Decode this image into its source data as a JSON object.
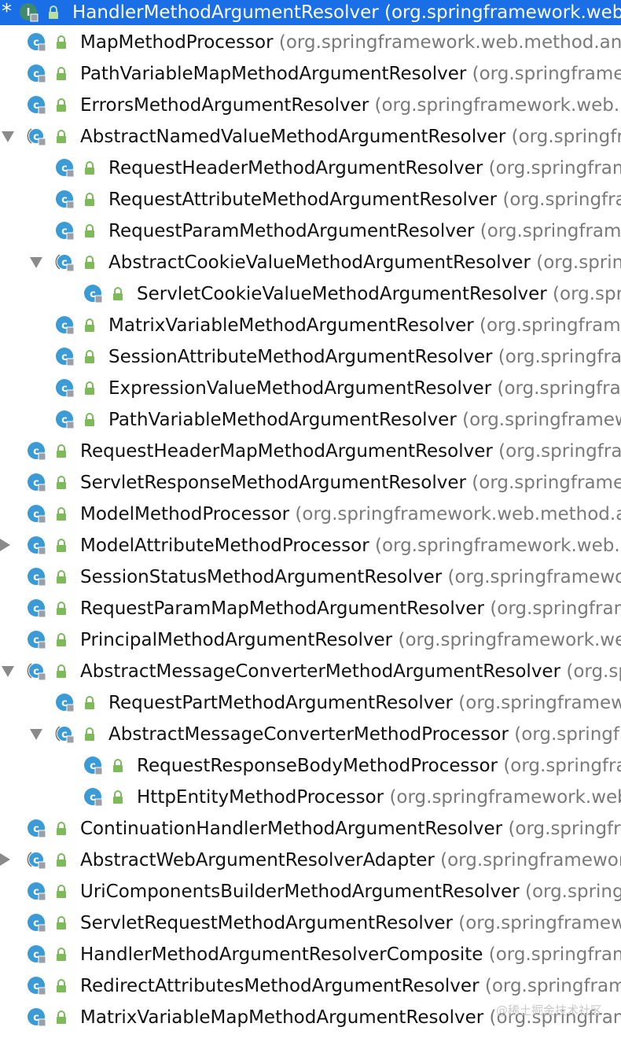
{
  "colors": {
    "selection": "#1a6fe6",
    "class_icon": "#3a9bd5",
    "interface_icon": "#3f8a6a",
    "lock_icon": "#7dba5a",
    "text": "#111111",
    "package_text": "#7a7a7a"
  },
  "header": {
    "marker": "*",
    "name": "HandlerMethodArgumentResolver",
    "pkg": "(org.springframework.web.method.support)",
    "icon": "interface-icon"
  },
  "items": [
    {
      "name": "MapMethodProcessor",
      "pkg": "(org.springframework.web.method.annotation)",
      "icon": "class-icon",
      "depth": 0,
      "toggle": ""
    },
    {
      "name": "PathVariableMapMethodArgumentResolver",
      "pkg": "(org.springframework.web.servlet.mvc.method.annotation)",
      "icon": "class-icon",
      "depth": 0,
      "toggle": ""
    },
    {
      "name": "ErrorsMethodArgumentResolver",
      "pkg": "(org.springframework.web.method.annotation)",
      "icon": "class-icon",
      "depth": 0,
      "toggle": ""
    },
    {
      "name": "AbstractNamedValueMethodArgumentResolver",
      "pkg": "(org.springframework.web.method.annotation)",
      "icon": "abstract-class-icon",
      "depth": 0,
      "toggle": "expanded"
    },
    {
      "name": "RequestHeaderMethodArgumentResolver",
      "pkg": "(org.springframework.web.method.annotation)",
      "icon": "class-icon",
      "depth": 1,
      "toggle": ""
    },
    {
      "name": "RequestAttributeMethodArgumentResolver",
      "pkg": "(org.springframework.web.servlet.mvc.method.annotation)",
      "icon": "class-icon",
      "depth": 1,
      "toggle": ""
    },
    {
      "name": "RequestParamMethodArgumentResolver",
      "pkg": "(org.springframework.web.method.annotation)",
      "icon": "class-icon",
      "depth": 1,
      "toggle": ""
    },
    {
      "name": "AbstractCookieValueMethodArgumentResolver",
      "pkg": "(org.springframework.web.method.annotation)",
      "icon": "abstract-class-icon",
      "depth": 1,
      "toggle": "expanded"
    },
    {
      "name": "ServletCookieValueMethodArgumentResolver",
      "pkg": "(org.springframework.web.servlet.mvc.method.annotation)",
      "icon": "class-icon",
      "depth": 2,
      "toggle": ""
    },
    {
      "name": "MatrixVariableMethodArgumentResolver",
      "pkg": "(org.springframework.web.servlet.mvc.method.annotation)",
      "icon": "class-icon",
      "depth": 1,
      "toggle": ""
    },
    {
      "name": "SessionAttributeMethodArgumentResolver",
      "pkg": "(org.springframework.web.servlet.mvc.method.annotation)",
      "icon": "class-icon",
      "depth": 1,
      "toggle": ""
    },
    {
      "name": "ExpressionValueMethodArgumentResolver",
      "pkg": "(org.springframework.web.method.annotation)",
      "icon": "class-icon",
      "depth": 1,
      "toggle": ""
    },
    {
      "name": "PathVariableMethodArgumentResolver",
      "pkg": "(org.springframework.web.servlet.mvc.method.annotation)",
      "icon": "class-icon",
      "depth": 1,
      "toggle": ""
    },
    {
      "name": "RequestHeaderMapMethodArgumentResolver",
      "pkg": "(org.springframework.web.method.annotation)",
      "icon": "class-icon",
      "depth": 0,
      "toggle": ""
    },
    {
      "name": "ServletResponseMethodArgumentResolver",
      "pkg": "(org.springframework.web.servlet.mvc.method.annotation)",
      "icon": "class-icon",
      "depth": 0,
      "toggle": ""
    },
    {
      "name": "ModelMethodProcessor",
      "pkg": "(org.springframework.web.method.annotation)",
      "icon": "class-icon",
      "depth": 0,
      "toggle": ""
    },
    {
      "name": "ModelAttributeMethodProcessor",
      "pkg": "(org.springframework.web.method.annotation)",
      "icon": "class-icon",
      "depth": 0,
      "toggle": "collapsed"
    },
    {
      "name": "SessionStatusMethodArgumentResolver",
      "pkg": "(org.springframework.web.method.annotation)",
      "icon": "class-icon",
      "depth": 0,
      "toggle": ""
    },
    {
      "name": "RequestParamMapMethodArgumentResolver",
      "pkg": "(org.springframework.web.method.annotation)",
      "icon": "class-icon",
      "depth": 0,
      "toggle": ""
    },
    {
      "name": "PrincipalMethodArgumentResolver",
      "pkg": "(org.springframework.web.servlet.mvc.method.annotation)",
      "icon": "class-icon",
      "depth": 0,
      "toggle": ""
    },
    {
      "name": "AbstractMessageConverterMethodArgumentResolver",
      "pkg": "(org.springframework.web.servlet.mvc.method.annotation)",
      "icon": "abstract-class-icon",
      "depth": 0,
      "toggle": "expanded"
    },
    {
      "name": "RequestPartMethodArgumentResolver",
      "pkg": "(org.springframework.web.servlet.mvc.method.annotation)",
      "icon": "class-icon",
      "depth": 1,
      "toggle": ""
    },
    {
      "name": "AbstractMessageConverterMethodProcessor",
      "pkg": "(org.springframework.web.servlet.mvc.method.annotation)",
      "icon": "abstract-class-icon",
      "depth": 1,
      "toggle": "expanded"
    },
    {
      "name": "RequestResponseBodyMethodProcessor",
      "pkg": "(org.springframework.web.servlet.mvc.method.annotation)",
      "icon": "class-icon",
      "depth": 2,
      "toggle": ""
    },
    {
      "name": "HttpEntityMethodProcessor",
      "pkg": "(org.springframework.web.servlet.mvc.method.annotation)",
      "icon": "class-icon",
      "depth": 2,
      "toggle": ""
    },
    {
      "name": "ContinuationHandlerMethodArgumentResolver",
      "pkg": "(org.springframework.web.servlet.mvc.method.annotation)",
      "icon": "class-icon",
      "depth": 0,
      "toggle": ""
    },
    {
      "name": "AbstractWebArgumentResolverAdapter",
      "pkg": "(org.springframework.web.method.annotation)",
      "icon": "abstract-class-icon",
      "depth": 0,
      "toggle": "collapsed"
    },
    {
      "name": "UriComponentsBuilderMethodArgumentResolver",
      "pkg": "(org.springframework.web.servlet.mvc.method.annotation)",
      "icon": "class-icon",
      "depth": 0,
      "toggle": ""
    },
    {
      "name": "ServletRequestMethodArgumentResolver",
      "pkg": "(org.springframework.web.servlet.mvc.method.annotation)",
      "icon": "class-icon",
      "depth": 0,
      "toggle": ""
    },
    {
      "name": "HandlerMethodArgumentResolverComposite",
      "pkg": "(org.springframework.web.method.support)",
      "icon": "class-icon",
      "depth": 0,
      "toggle": ""
    },
    {
      "name": "RedirectAttributesMethodArgumentResolver",
      "pkg": "(org.springframework.web.servlet.mvc.method.annotation)",
      "icon": "class-icon",
      "depth": 0,
      "toggle": ""
    },
    {
      "name": "MatrixVariableMapMethodArgumentResolver",
      "pkg": "(org.springframework.web.servlet.mvc.method.annotation)",
      "icon": "class-icon",
      "depth": 0,
      "toggle": ""
    }
  ],
  "watermark": "@稀土掘金技术社区"
}
